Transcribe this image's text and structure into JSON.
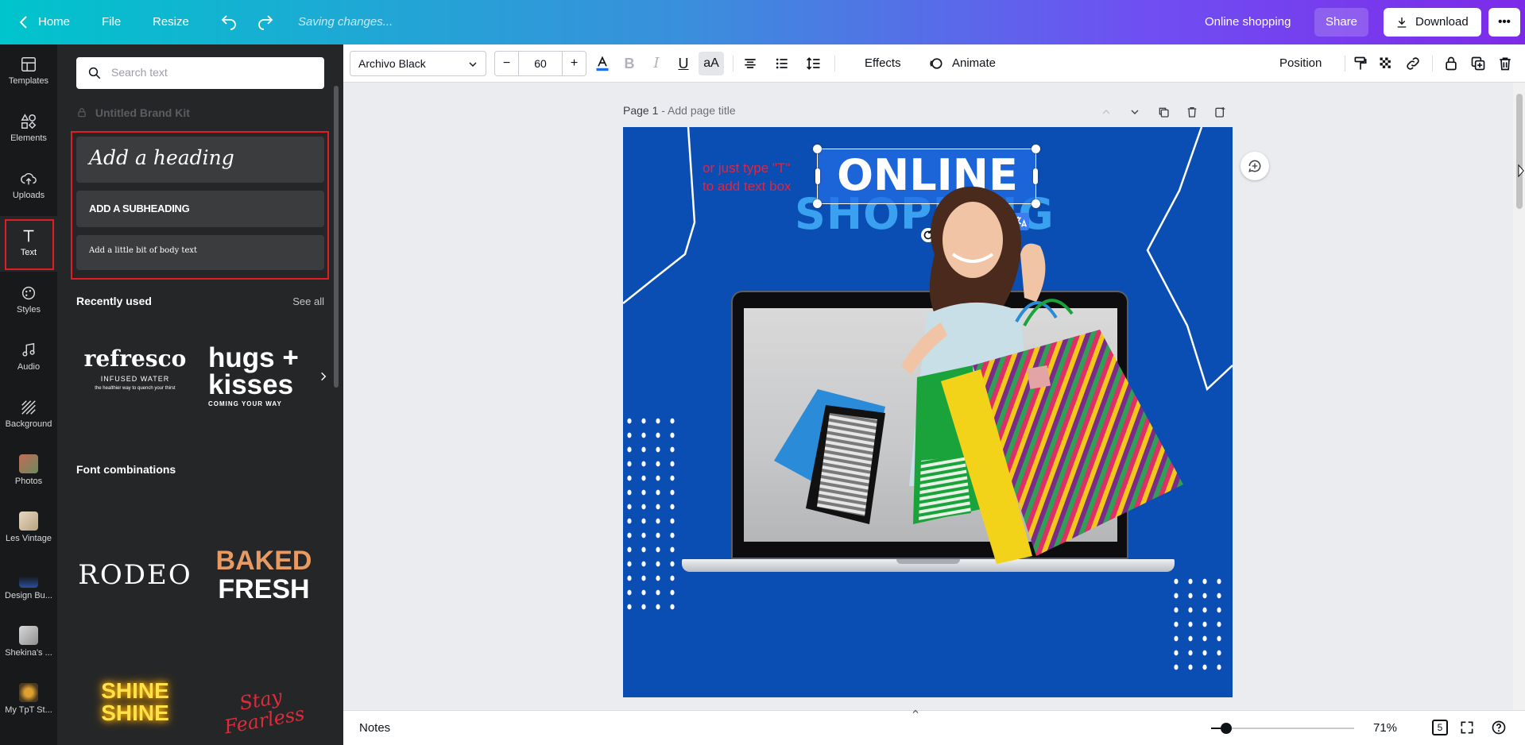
{
  "topbar": {
    "home": "Home",
    "file": "File",
    "resize": "Resize",
    "status": "Saving changes...",
    "project_title": "Online shopping",
    "share": "Share",
    "download": "Download"
  },
  "rail": [
    {
      "label": "Templates",
      "icon": "templates-icon"
    },
    {
      "label": "Elements",
      "icon": "elements-icon"
    },
    {
      "label": "Uploads",
      "icon": "upload-icon"
    },
    {
      "label": "Text",
      "icon": "text-icon"
    },
    {
      "label": "Styles",
      "icon": "styles-icon"
    },
    {
      "label": "Audio",
      "icon": "audio-icon"
    },
    {
      "label": "Background",
      "icon": "background-icon"
    },
    {
      "label": "Photos",
      "icon": "photos-icon"
    },
    {
      "label": "Les Vintage",
      "icon": "folder-thumb-icon"
    },
    {
      "label": "Design Bu...",
      "icon": "folder-thumb-icon"
    },
    {
      "label": "Shekina's ...",
      "icon": "folder-thumb-icon"
    },
    {
      "label": "My TpT St...",
      "icon": "folder-thumb-icon"
    }
  ],
  "panel": {
    "search_placeholder": "Search text",
    "brand_kit": "Untitled Brand Kit",
    "add_heading": "Add a heading",
    "add_subheading": "ADD A SUBHEADING",
    "add_body": "Add a little bit of body text",
    "recently_used": "Recently used",
    "see_all": "See all",
    "font_combinations": "Font combinations",
    "recent": {
      "refresco": "refresco",
      "refresco_sub": "INFUSED WATER",
      "refresco_tag": "the healthier way to quench your thirst",
      "hugs1": "hugs +",
      "hugs2": "kisses",
      "hugs_sub": "COMING YOUR WAY"
    },
    "combos": {
      "rodeo": "RODEO",
      "baked": "BAKED",
      "fresh": "FRESH",
      "shine": "SHINE",
      "stay": "Stay",
      "fearless": "Fearless"
    }
  },
  "toolbar": {
    "font": "Archivo Black",
    "font_size": "60",
    "effects": "Effects",
    "animate": "Animate",
    "position": "Position"
  },
  "page": {
    "label": "Page 1",
    "title_placeholder": "- Add page title"
  },
  "design": {
    "hint1": "or just type \"T\"",
    "hint2": "to add text box",
    "headline1": "ONLINE",
    "headline2": "SHOPPING"
  },
  "bottombar": {
    "notes": "Notes",
    "zoom": "71%",
    "page_count": "5"
  },
  "colors": {
    "design_bg": "#0a4db3",
    "headline2": "#3aa0f0",
    "hint": "#e8233a",
    "highlight": "#e31b23"
  }
}
